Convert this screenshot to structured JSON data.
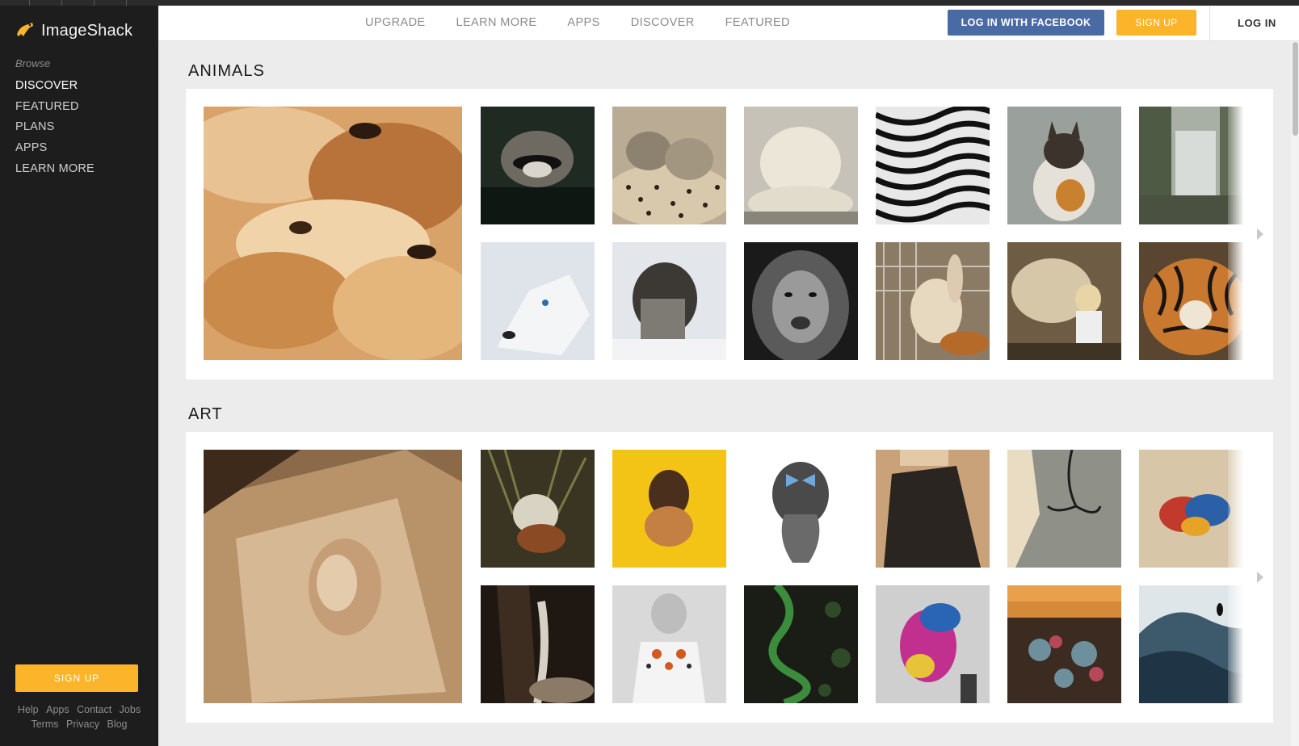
{
  "app": {
    "name": "ImageShack",
    "logo_icon": "frog-icon"
  },
  "sidebar": {
    "browse_label": "Browse",
    "items": [
      {
        "label": "DISCOVER",
        "active": true
      },
      {
        "label": "FEATURED",
        "active": false
      },
      {
        "label": "PLANS",
        "active": false
      },
      {
        "label": "APPS",
        "active": false
      },
      {
        "label": "LEARN MORE",
        "active": false
      }
    ],
    "signup_label": "SIGN UP",
    "footer_row1": [
      "Help",
      "Apps",
      "Contact",
      "Jobs"
    ],
    "footer_row2": [
      "Terms",
      "Privacy",
      "Blog"
    ]
  },
  "header": {
    "nav": [
      "UPGRADE",
      "LEARN MORE",
      "APPS",
      "DISCOVER",
      "FEATURED"
    ],
    "facebook_label": "LOG IN WITH FACEBOOK",
    "signup_label": "SIGN UP",
    "login_label": "LOG IN"
  },
  "colors": {
    "accent_yellow": "#fcb42b",
    "facebook_blue": "#4a6aa5",
    "sidebar_bg": "#1d1d1d"
  },
  "sections": [
    {
      "title": "ANIMALS",
      "images": [
        "golden retriever puppies",
        "raccoon",
        "cheetahs",
        "white lion",
        "zebras",
        "kitten",
        "waterfall",
        "white wolf",
        "cat in scarf",
        "lion face",
        "rabbit",
        "girl with sheep",
        "tiger"
      ]
    },
    {
      "title": "ART",
      "images": [
        "woman portrait sculpture",
        "fox painting",
        "woman on yellow",
        "braided hair with bow",
        "woman in lace dress",
        "tree silhouette",
        "abstract butterfly",
        "waterfall painting",
        "embroidered shirt",
        "green snake",
        "peacock street art",
        "tree with roots",
        "surfer wave"
      ]
    }
  ]
}
